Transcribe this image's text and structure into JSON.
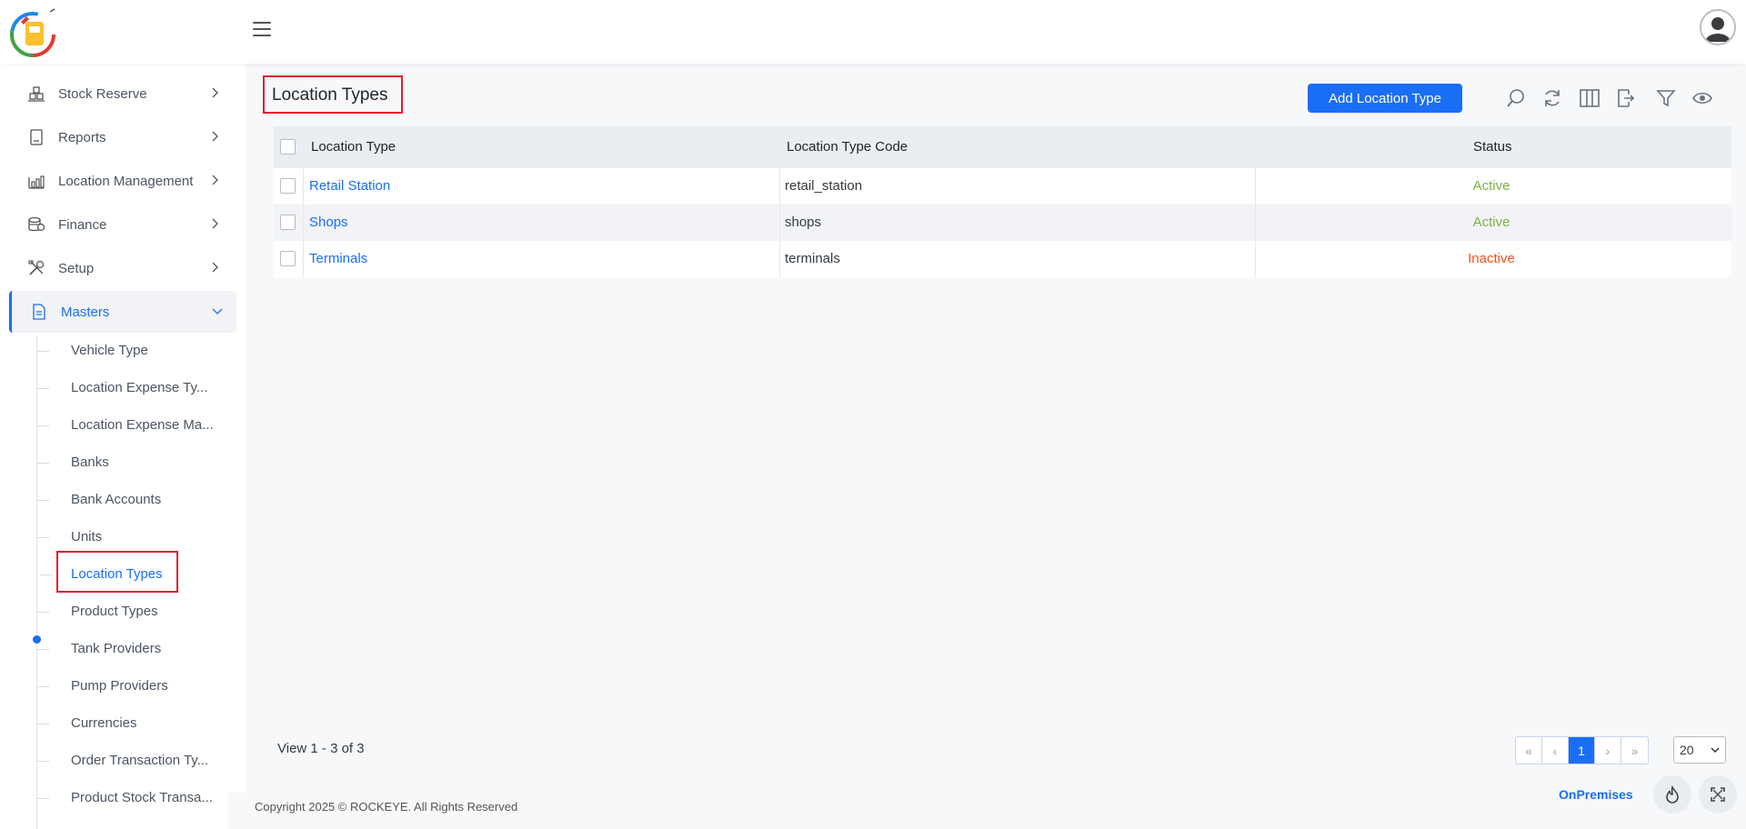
{
  "header": {
    "menu_icon": "hamburger-icon",
    "avatar_icon": "user-avatar-icon",
    "logo_icon": "fuel-logo-icon"
  },
  "sidebar": {
    "items": [
      {
        "label": "Stock Reserve",
        "icon": "warehouse-icon"
      },
      {
        "label": "Reports",
        "icon": "report-icon"
      },
      {
        "label": "Location Management",
        "icon": "location-chart-icon"
      },
      {
        "label": "Finance",
        "icon": "coins-icon"
      },
      {
        "label": "Setup",
        "icon": "tools-icon"
      },
      {
        "label": "Masters",
        "icon": "document-icon"
      }
    ],
    "sub_items": [
      "Vehicle Type",
      "Location Expense Ty...",
      "Location Expense Ma...",
      "Banks",
      "Bank Accounts",
      "Units",
      "Location Types",
      "Product Types",
      "Tank Providers",
      "Pump Providers",
      "Currencies",
      "Order Transaction Ty...",
      "Product Stock Transa..."
    ]
  },
  "main": {
    "title": "Location Types",
    "add_button": "Add Location Type",
    "toolbar_icons": [
      "search-icon",
      "refresh-icon",
      "columns-icon",
      "export-icon",
      "filter-icon",
      "eye-icon"
    ]
  },
  "table": {
    "columns": [
      "Location Type",
      "Location Type Code",
      "Status"
    ],
    "rows": [
      {
        "name": "Retail Station",
        "code": "retail_station",
        "status": "Active"
      },
      {
        "name": "Shops",
        "code": "shops",
        "status": "Active"
      },
      {
        "name": "Terminals",
        "code": "terminals",
        "status": "Inactive"
      }
    ]
  },
  "pagination": {
    "view_text": "View 1 - 3 of 3",
    "first": "«",
    "prev": "‹",
    "current": "1",
    "next": "›",
    "last": "»",
    "page_size": "20"
  },
  "footer": {
    "copyright": "Copyright 2025 © ROCKEYE. All Rights Reserved",
    "mode": "OnPremises"
  },
  "colors": {
    "accent": "#1a6ef5",
    "active": "#7cb342",
    "inactive": "#f4511e",
    "highlight": "#e01e2b"
  }
}
